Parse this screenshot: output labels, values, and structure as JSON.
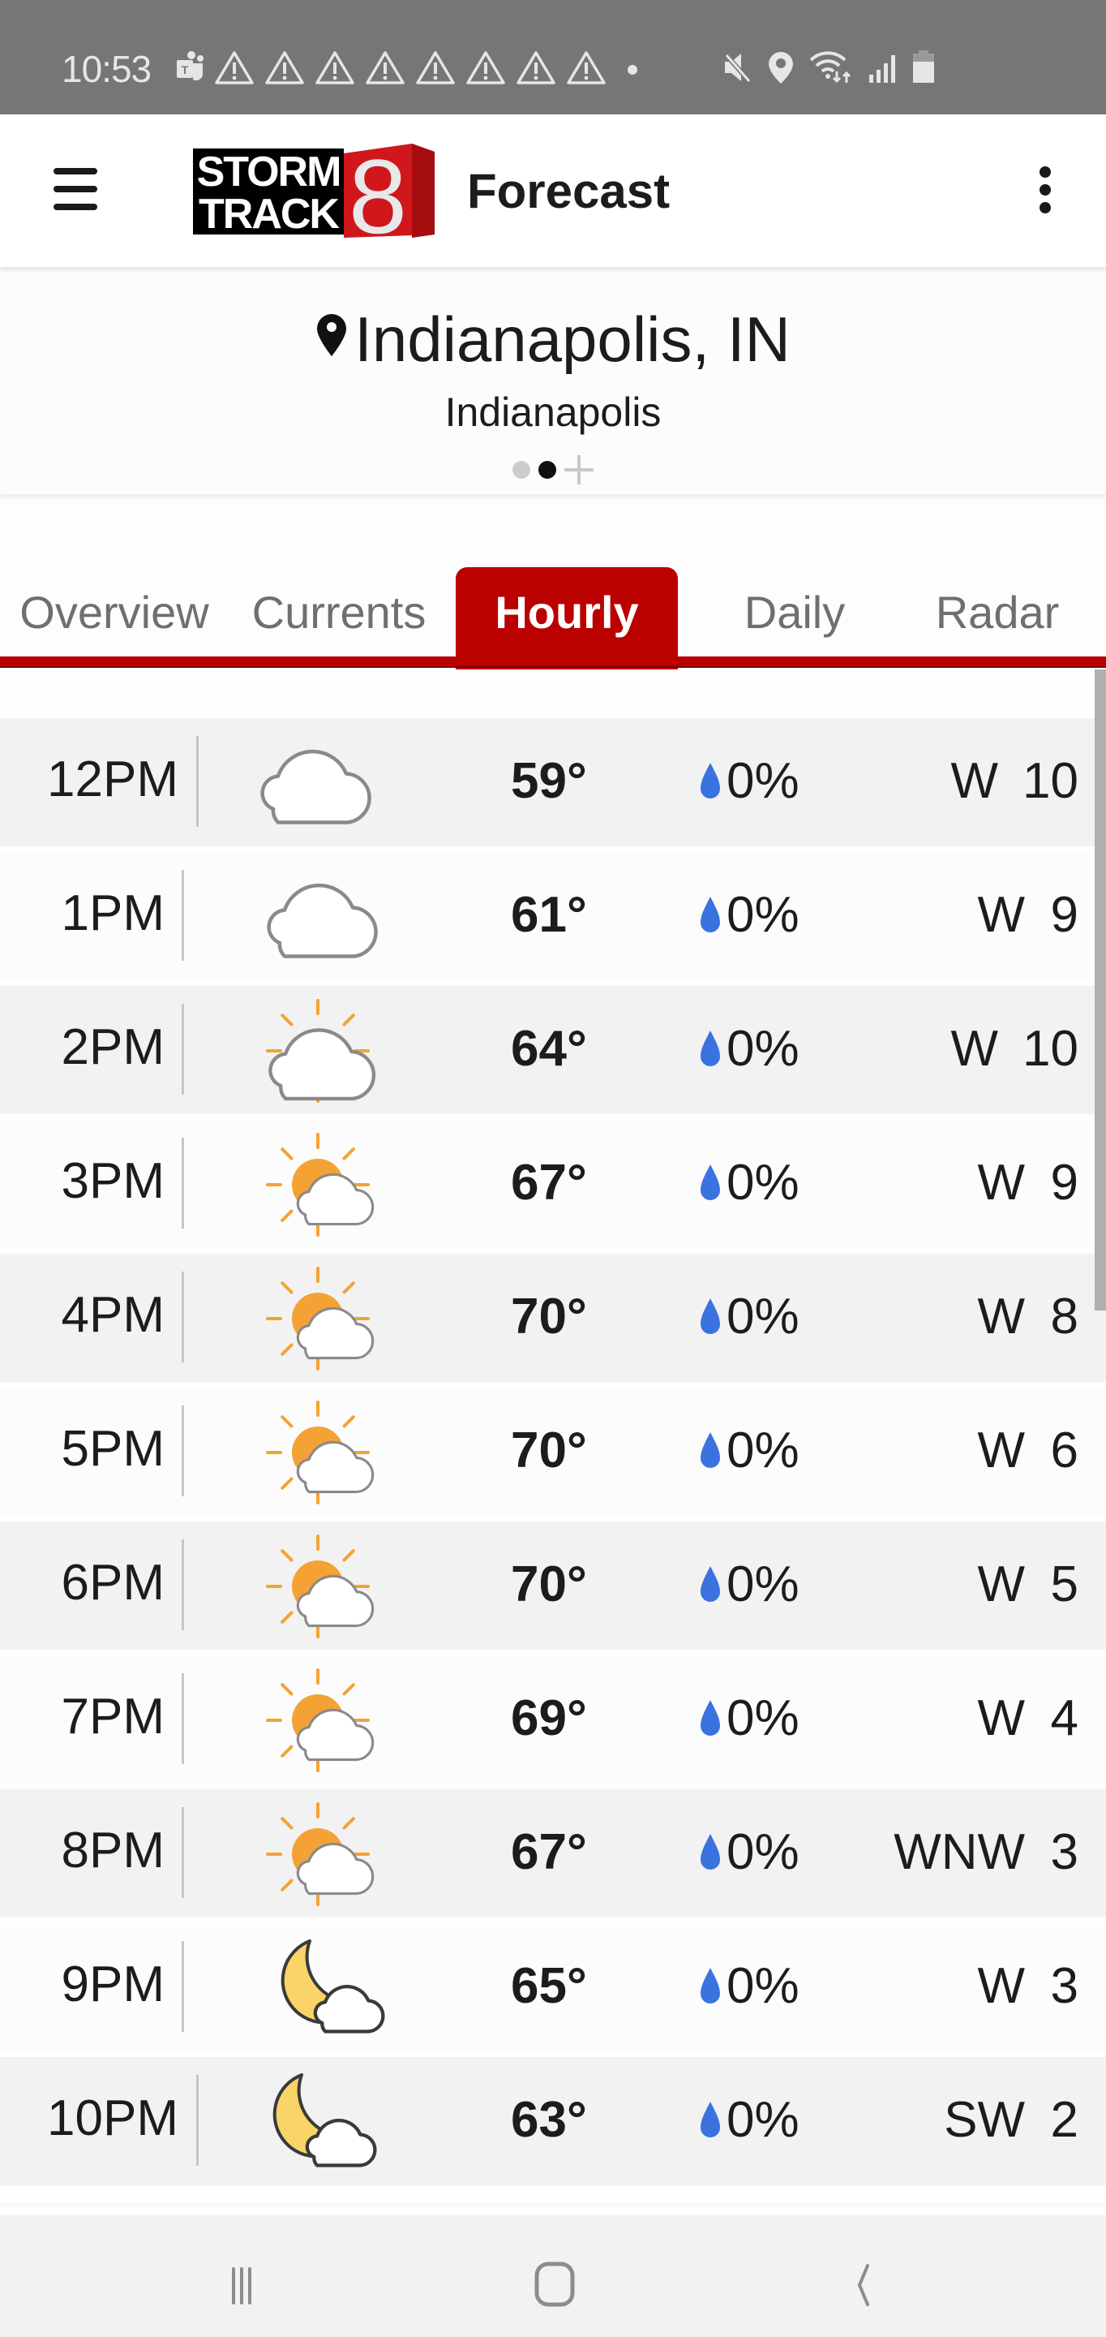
{
  "status_bar": {
    "time": "10:53",
    "notification_icons": [
      "teams-icon",
      "warning-icon",
      "warning-icon",
      "warning-icon",
      "warning-icon",
      "warning-icon",
      "warning-icon",
      "warning-icon",
      "warning-icon",
      "more-dot-icon"
    ],
    "system_icons": [
      "mute-icon",
      "location-icon",
      "wifi-icon",
      "signal-icon",
      "battery-icon"
    ]
  },
  "app_bar": {
    "menu_icon": "hamburger-menu-icon",
    "logo_line1": "STORM",
    "logo_line2": "TRACK",
    "logo_number": "8",
    "title": "Forecast",
    "overflow_icon": "more-vert-icon"
  },
  "location": {
    "name": "Indianapolis, IN",
    "subtitle": "Indianapolis",
    "pager_total": 2,
    "pager_active_index": 1
  },
  "tabs": [
    {
      "label": "Overview",
      "active": false
    },
    {
      "label": "Currents",
      "active": false
    },
    {
      "label": "Hourly",
      "active": true
    },
    {
      "label": "Daily",
      "active": false
    },
    {
      "label": "Radar",
      "active": false
    }
  ],
  "colors": {
    "brand_red": "#bb0000",
    "precip_blue": "#3a72e0",
    "sun_orange": "#f5a235",
    "moon_yellow": "#fad467"
  },
  "hourly": [
    {
      "time": "12PM",
      "icon": "cloudy",
      "temp": "59°",
      "precip": "0%",
      "wind_dir": "W",
      "wind_speed": "10"
    },
    {
      "time": "1PM",
      "icon": "cloudy",
      "temp": "61°",
      "precip": "0%",
      "wind_dir": "W",
      "wind_speed": "9"
    },
    {
      "time": "2PM",
      "icon": "mostly-cloudy-day",
      "temp": "64°",
      "precip": "0%",
      "wind_dir": "W",
      "wind_speed": "10"
    },
    {
      "time": "3PM",
      "icon": "partly-cloudy-day",
      "temp": "67°",
      "precip": "0%",
      "wind_dir": "W",
      "wind_speed": "9"
    },
    {
      "time": "4PM",
      "icon": "partly-cloudy-day",
      "temp": "70°",
      "precip": "0%",
      "wind_dir": "W",
      "wind_speed": "8"
    },
    {
      "time": "5PM",
      "icon": "partly-cloudy-day",
      "temp": "70°",
      "precip": "0%",
      "wind_dir": "W",
      "wind_speed": "6"
    },
    {
      "time": "6PM",
      "icon": "partly-cloudy-day",
      "temp": "70°",
      "precip": "0%",
      "wind_dir": "W",
      "wind_speed": "5"
    },
    {
      "time": "7PM",
      "icon": "partly-cloudy-day",
      "temp": "69°",
      "precip": "0%",
      "wind_dir": "W",
      "wind_speed": "4"
    },
    {
      "time": "8PM",
      "icon": "partly-cloudy-day",
      "temp": "67°",
      "precip": "0%",
      "wind_dir": "WNW",
      "wind_speed": "3"
    },
    {
      "time": "9PM",
      "icon": "partly-cloudy-night",
      "temp": "65°",
      "precip": "0%",
      "wind_dir": "W",
      "wind_speed": "3"
    },
    {
      "time": "10PM",
      "icon": "partly-cloudy-night",
      "temp": "63°",
      "precip": "0%",
      "wind_dir": "SW",
      "wind_speed": "2"
    }
  ],
  "nav_bar": {
    "buttons": [
      "recent-apps-icon",
      "home-icon",
      "back-icon"
    ]
  }
}
